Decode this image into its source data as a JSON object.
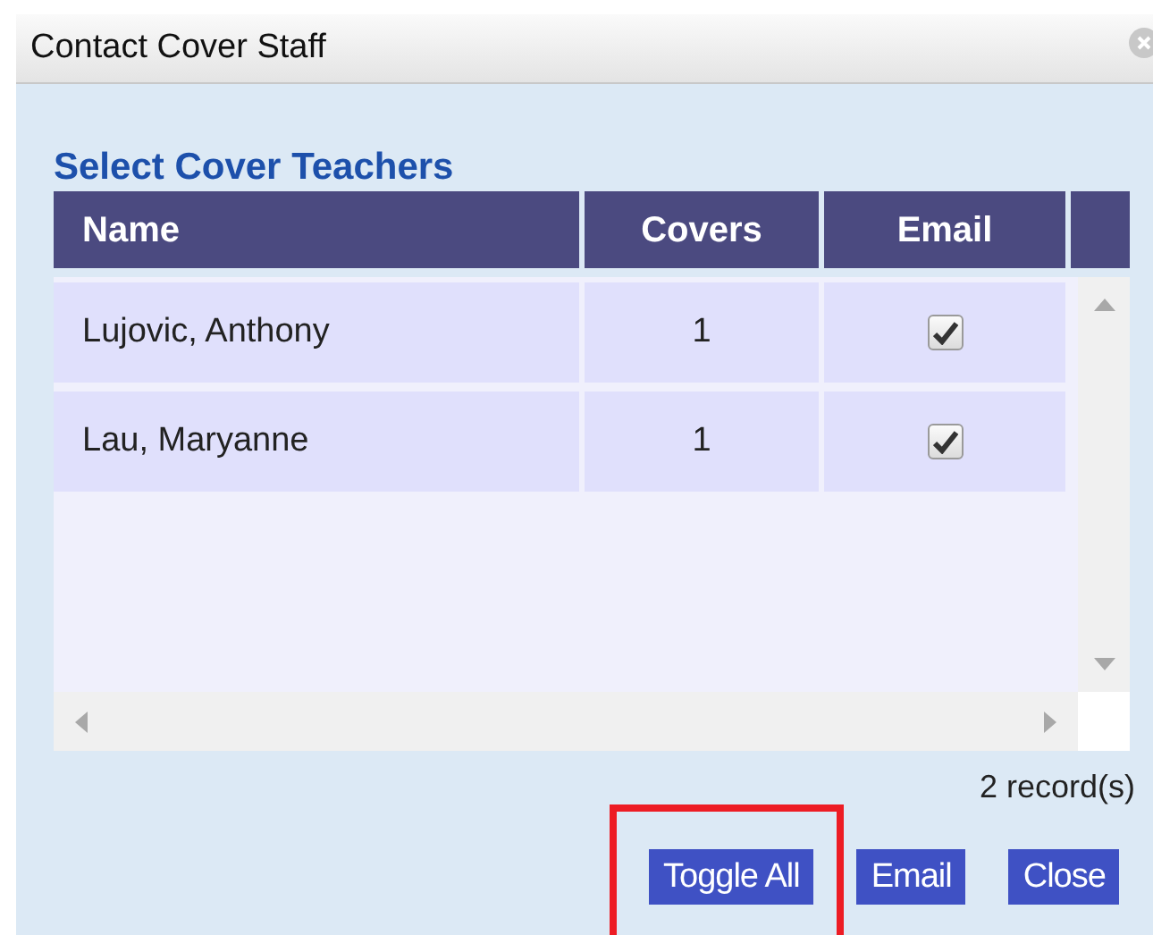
{
  "window": {
    "title": "Contact Cover Staff"
  },
  "section_title": "Select Cover Teachers",
  "table": {
    "columns": [
      "Name",
      "Covers",
      "Email"
    ],
    "rows": [
      {
        "name": "Lujovic, Anthony",
        "covers": "1",
        "email_checked": true
      },
      {
        "name": "Lau, Maryanne",
        "covers": "1",
        "email_checked": true
      }
    ]
  },
  "record_count": "2 record(s)",
  "buttons": [
    {
      "label": "Toggle All",
      "highlighted": true
    },
    {
      "label": "Email",
      "highlighted": false
    },
    {
      "label": "Close",
      "highlighted": false
    }
  ]
}
